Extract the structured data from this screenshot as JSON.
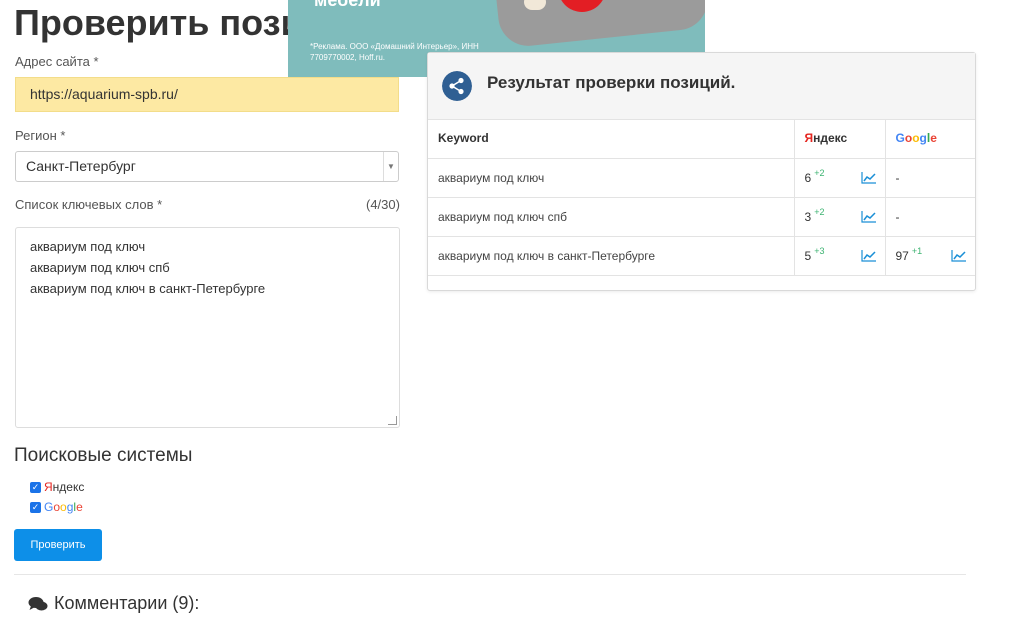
{
  "page": {
    "title": "Проверить позиции сайта"
  },
  "ad": {
    "headline": "мебели",
    "legal": "*Реклама. ООО «Домашний Интерьер», ИНН 7709770002, Hoff.ru."
  },
  "form": {
    "url_label": "Адрес сайта *",
    "url_value": "https://aquarium-spb.ru/",
    "region_label": "Регион *",
    "region_value": "Санкт-Петербург",
    "keywords_label": "Список ключевых слов *",
    "keywords_count": "(4/30)",
    "keywords": [
      "аквариум под ключ",
      "аквариум под ключ спб",
      "аквариум под ключ в санкт-Петербурге"
    ],
    "engines_heading": "Поисковые системы",
    "engines": [
      {
        "label": "Яндекс",
        "checked": true
      },
      {
        "label": "Google",
        "checked": true
      }
    ],
    "submit_label": "Проверить"
  },
  "results": {
    "title": "Результат проверки позиций.",
    "columns": {
      "keyword": "Keyword",
      "yandex": "Яндекс",
      "google": "Google"
    },
    "rows": [
      {
        "keyword": "аквариум под ключ",
        "yandex": "6",
        "yandex_delta": "+2",
        "google": "-",
        "google_delta": ""
      },
      {
        "keyword": "аквариум под ключ спб",
        "yandex": "3",
        "yandex_delta": "+2",
        "google": "-",
        "google_delta": ""
      },
      {
        "keyword": "аквариум под ключ в санкт-Петербурге",
        "yandex": "5",
        "yandex_delta": "+3",
        "google": "97",
        "google_delta": "+1"
      }
    ]
  },
  "comments": {
    "label": "Комментарии (9):"
  },
  "colors": {
    "accent": "#0d8fe8",
    "url_bg": "#fde9a3",
    "delta_green": "#3cb371",
    "yandex_red": "#e52620"
  }
}
